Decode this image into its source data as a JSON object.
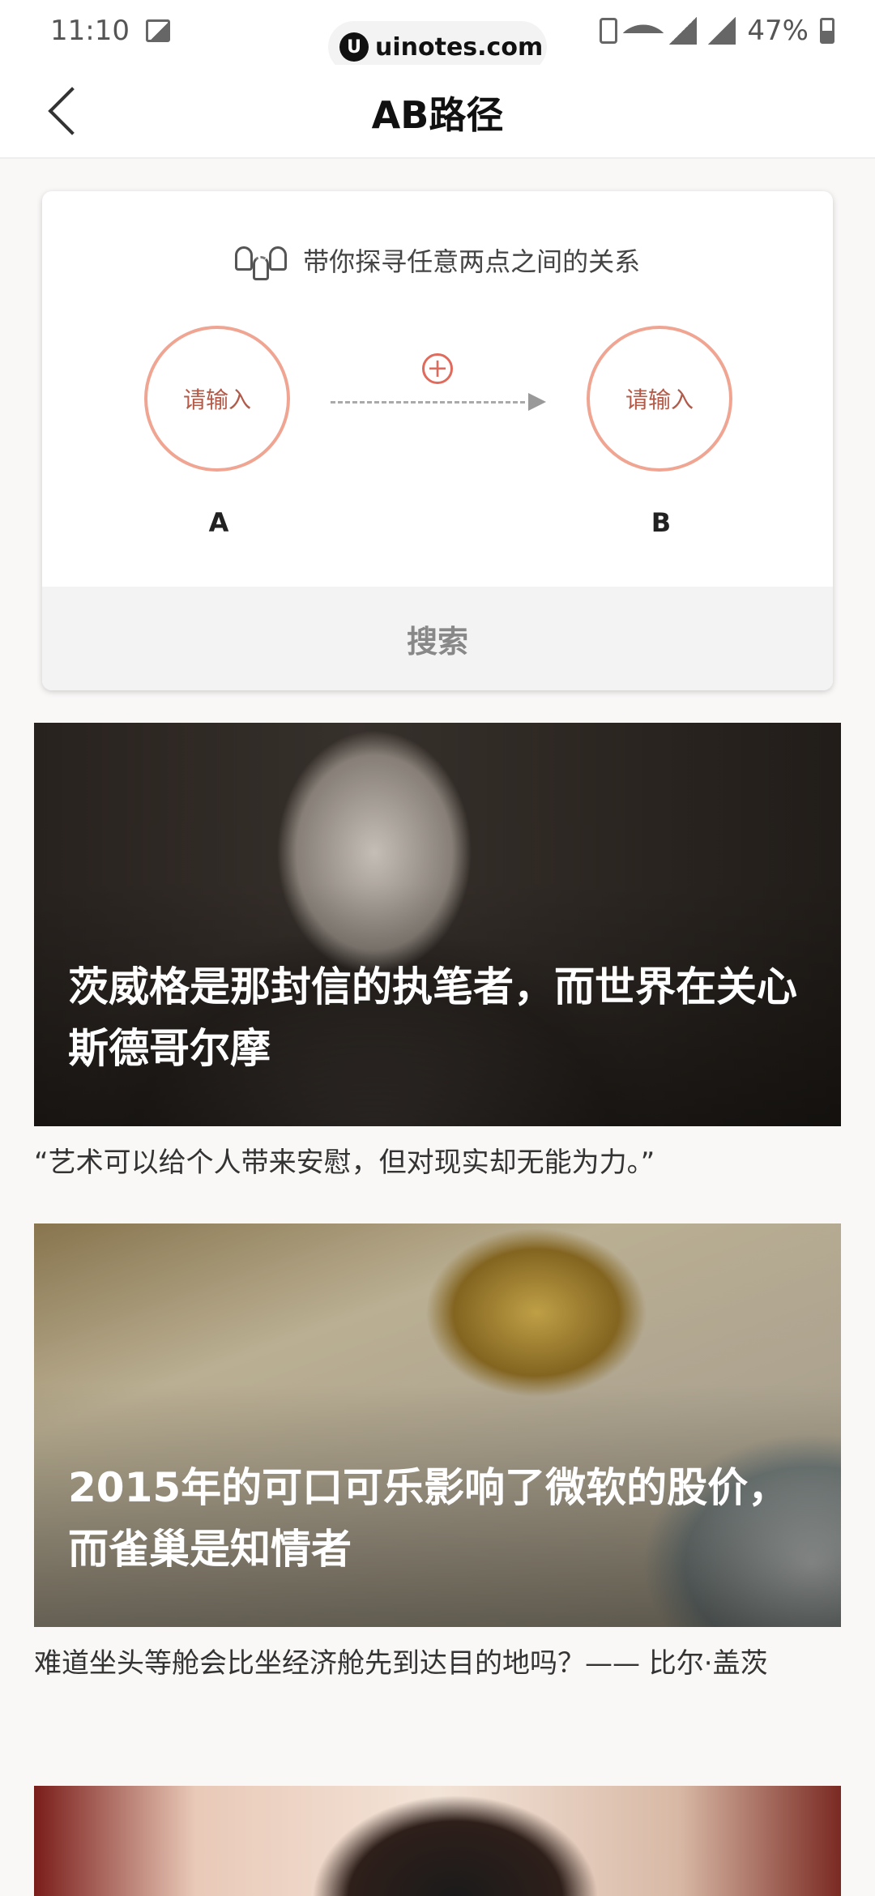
{
  "status_bar": {
    "time": "11:10",
    "url": "uinotes.com",
    "battery": "47%"
  },
  "nav": {
    "title": "AB路径"
  },
  "ab_search": {
    "header": "带你探寻任意两点之间的关系",
    "node_a_placeholder": "请输入",
    "node_b_placeholder": "请输入",
    "label_a": "A",
    "label_b": "B",
    "plus_symbol": "+",
    "search_button": "搜索"
  },
  "articles": [
    {
      "title": "茨威格是那封信的执笔者，而世界在关心斯德哥尔摩",
      "caption": "“艺术可以给个人带来安慰，但对现实却无能为力。”"
    },
    {
      "title": "2015年的可口可乐影响了微软的股价，而雀巢是知情者",
      "caption": "难道坐头等舱会比坐经济舱先到达目的地吗？—— 比尔·盖茨"
    }
  ],
  "colors": {
    "accent": "#f0a592",
    "accent_text": "#b35a48",
    "plus_icon": "#e06a5b",
    "page_bg": "#faf8f7"
  }
}
